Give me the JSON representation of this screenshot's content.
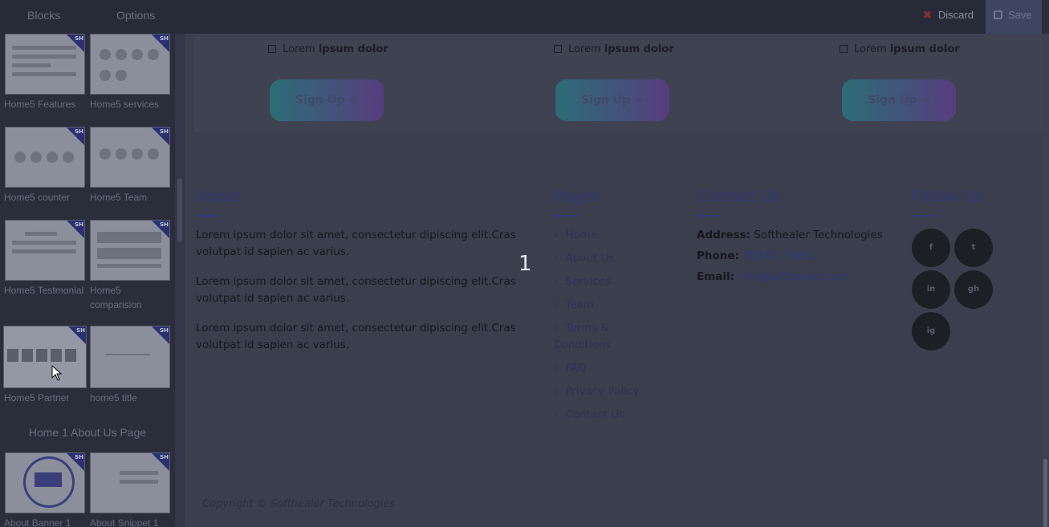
{
  "topbar": {
    "tabs": [
      "Blocks",
      "Options"
    ],
    "discard_label": "Discard",
    "save_label": "Save"
  },
  "sidebar": {
    "items": [
      {
        "label": "Home5 Features"
      },
      {
        "label": "Home5 services"
      },
      {
        "label": "Home5 counter"
      },
      {
        "label": "Home5 Team"
      },
      {
        "label": "Home5 Testmonial"
      },
      {
        "label": "Home5 comparision"
      },
      {
        "label": "Home5 Partner"
      },
      {
        "label": "home5 title"
      }
    ],
    "section_title": "Home 1 About Us Page",
    "section_items": [
      {
        "label": "About Banner 1"
      },
      {
        "label": "About Snippet 1"
      }
    ],
    "thumb_tag": "SH"
  },
  "main": {
    "ext_links": [
      {
        "prefix": "Lorem ",
        "bold": "ipsum dolor"
      },
      {
        "prefix": "Lorem ",
        "bold": "ipsum dolor"
      },
      {
        "prefix": "Lorem ",
        "bold": "ipsum dolor"
      }
    ],
    "signup_label": "Sign Up",
    "about": {
      "heading": "About",
      "paragraphs": [
        "Lorem ipsum dolor sit amet, consectetur dipiscing elit.Cras volutpat id sapien ac varius.",
        "Lorem ipsum dolor sit amet, consectetur dipiscing elit.Cras volutpat id sapien ac varius.",
        "Lorem ipsum dolor sit amet, consectetur dipiscing elit.Cras volutpat id sapien ac varius."
      ]
    },
    "pages": {
      "heading": "Pages",
      "links": [
        "Home",
        "About Us",
        "Services",
        "Team",
        "Terms & Conditions",
        "FAQ",
        "Privacy Policy",
        "Contact Us"
      ]
    },
    "contact": {
      "heading": "Contact Us",
      "address_label": "Address:",
      "address_value": "Softhealer Technologies",
      "phone_label": "Phone:",
      "phone_value": "79845 75681",
      "email_label": "Email:",
      "email_value": "info@softhealer.com"
    },
    "follow": {
      "heading": "Follow Us",
      "icons": [
        "f",
        "t",
        "in",
        "gh",
        "ig"
      ]
    },
    "overlay_number": "1",
    "copyright": "Copyright © Softhealer Technologies"
  }
}
